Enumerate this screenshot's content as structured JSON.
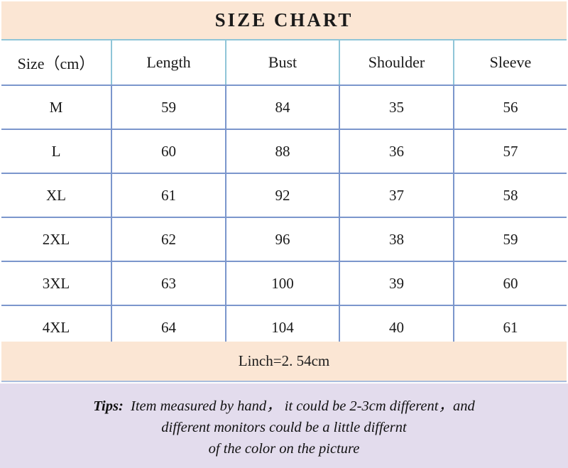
{
  "title": {
    "text": "SIZE CHART"
  },
  "table": {
    "columns": [
      "Size（cm）",
      "Length",
      "Bust",
      "Shoulder",
      "Sleeve"
    ],
    "rows": [
      {
        "size": "M",
        "length": "59",
        "bust": "84",
        "shoulder": "35",
        "sleeve": "56"
      },
      {
        "size": "L",
        "length": "60",
        "bust": "88",
        "shoulder": "36",
        "sleeve": "57"
      },
      {
        "size": "XL",
        "length": "61",
        "bust": "92",
        "shoulder": "37",
        "sleeve": "58"
      },
      {
        "size": "2XL",
        "length": "62",
        "bust": "96",
        "shoulder": "38",
        "sleeve": "59"
      },
      {
        "size": "3XL",
        "length": "63",
        "bust": "100",
        "shoulder": "39",
        "sleeve": "60"
      },
      {
        "size": "4XL",
        "length": "64",
        "bust": "104",
        "shoulder": "40",
        "sleeve": "61"
      }
    ]
  },
  "conversion": {
    "note": "Linch=2. 54cm"
  },
  "tips": {
    "label": "Tips:",
    "line1_rest": "  Item measured by hand， it could be 2-3cm different，and",
    "line2": "different monitors could be a little differnt",
    "line3": "of the color on the picture"
  },
  "colors": {
    "band_peach": "#fbe6d4",
    "grid_blue": "#7b96cc",
    "header_rule": "#8fc5d8",
    "tips_lavender": "#e3dced",
    "text": "#1a1a1a"
  }
}
